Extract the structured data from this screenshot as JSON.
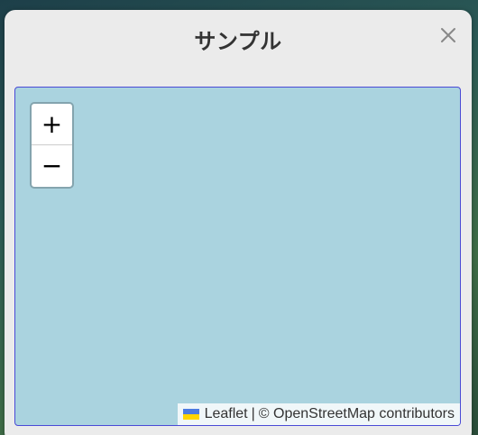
{
  "dialog": {
    "title": "サンプル",
    "close_icon": "close-icon"
  },
  "map": {
    "background_color": "#aad3df",
    "zoom_in_label": "+",
    "zoom_out_label": "−",
    "attribution": {
      "flag_icon": "ukraine-flag-icon",
      "leaflet_label": "Leaflet",
      "separator": "|",
      "copyright": "© OpenStreetMap contributors"
    }
  }
}
